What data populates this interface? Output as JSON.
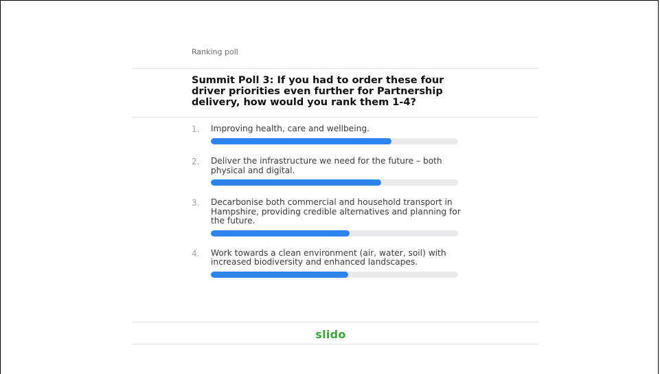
{
  "poll": {
    "type_label": "Ranking poll",
    "question": "Summit Poll 3: If you had to order these four driver priorities even further for Partnership delivery, how would you rank them 1-4?",
    "options": [
      {
        "number": "1.",
        "text": "Improving health, care and wellbeing.",
        "score": 0.73
      },
      {
        "number": "2.",
        "text": "Deliver the infrastructure we need for the future – both physical and digital.",
        "score": 0.69
      },
      {
        "number": "3.",
        "text": "Decarbonise both commercial and household transport in Hampshire, providing credible alternatives and planning for the future.",
        "score": 0.56
      },
      {
        "number": "4.",
        "text": "Work towards a clean environment (air, water, soil) with increased biodiversity and enhanced landscapes.",
        "score": 0.555
      }
    ]
  },
  "footer": {
    "logo_text": "slido"
  },
  "colors": {
    "bar_fill": "#2d84ee",
    "bar_track": "#e9e9eb",
    "logo": "#3aa33a"
  }
}
